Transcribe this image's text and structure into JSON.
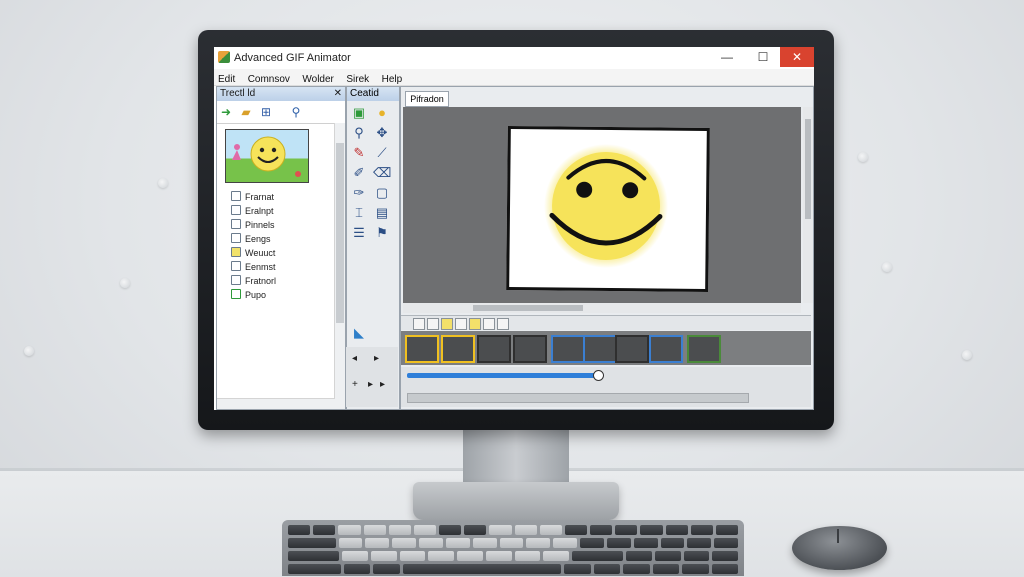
{
  "window": {
    "title": "Advanced GIF Animator",
    "minimize": "—",
    "maximize": "☐",
    "close": "✕"
  },
  "menu": [
    "Edit",
    "Comnsov",
    "Wolder",
    "Sirek",
    "Help"
  ],
  "left_panel": {
    "header": "Trectl ld",
    "close": "✕",
    "tree": [
      "Frarnat",
      "Eralnpt",
      "Pinnels",
      "Eengs",
      "Weuuct",
      "Eenmst",
      "Fratnorl",
      "Pupo"
    ]
  },
  "tools_panel": {
    "header": "Ceatid"
  },
  "preview": {
    "tab": "Pifradon"
  },
  "icons": {
    "back": "◂",
    "play": "▸",
    "plus": "+"
  },
  "timeline": {
    "progress": 0.56
  },
  "colors": {
    "accent": "#2f7fd9",
    "smiley": "#f6e35a",
    "close_button": "#d9432f"
  }
}
